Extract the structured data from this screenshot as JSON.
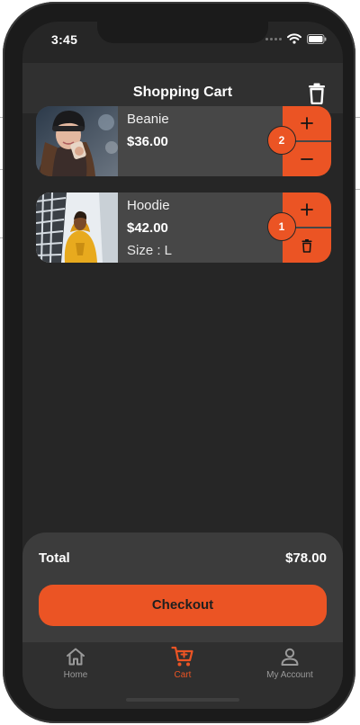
{
  "status_bar": {
    "time": "3:45"
  },
  "header": {
    "title": "Shopping Cart",
    "clear_icon": "trash-icon"
  },
  "cart": {
    "items": [
      {
        "name": "Beanie",
        "price": "$36.00",
        "quantity": "2",
        "image": "woman-in-black-beanie-photo"
      },
      {
        "name": "Hoodie",
        "price": "$42.00",
        "size": "Size : L",
        "quantity": "1",
        "image": "man-in-yellow-hoodie-photo"
      }
    ]
  },
  "summary": {
    "total_label": "Total",
    "total_value": "$78.00",
    "checkout_label": "Checkout"
  },
  "tabs": [
    {
      "label": "Home",
      "icon": "home-icon",
      "active": false
    },
    {
      "label": "Cart",
      "icon": "cart-icon",
      "active": true
    },
    {
      "label": "My Account",
      "icon": "user-icon",
      "active": false
    }
  ],
  "colors": {
    "accent": "#eb5424",
    "background": "#262626",
    "card": "#474747"
  }
}
